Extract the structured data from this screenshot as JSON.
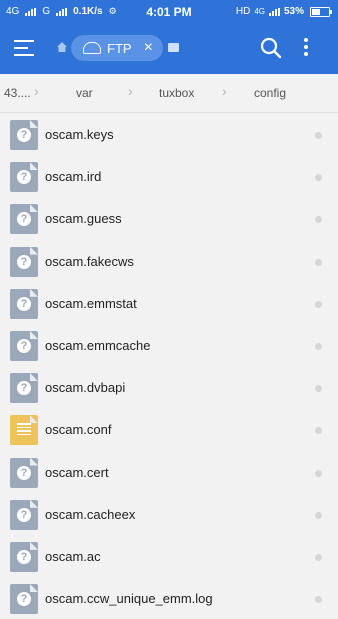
{
  "status_bar": {
    "carrier1": "4G",
    "carrier2": "G",
    "speed": "0.1K/s",
    "time": "4:01 PM",
    "hd": "HD",
    "network": "4G",
    "battery": "53%",
    "battery_level": 0.53
  },
  "app_bar": {
    "tab_label": "FTP",
    "close_glyph": "×",
    "icons": [
      "menu-icon",
      "home-icon",
      "ftp-icon",
      "close-icon",
      "chat-icon",
      "search-icon",
      "more-vert-icon"
    ]
  },
  "breadcrumb": {
    "items": [
      "43....",
      "var",
      "tuxbox",
      "config"
    ]
  },
  "files": [
    {
      "name": "oscam.keys",
      "icon": "unknown-file-icon"
    },
    {
      "name": "oscam.ird",
      "icon": "unknown-file-icon"
    },
    {
      "name": "oscam.guess",
      "icon": "unknown-file-icon"
    },
    {
      "name": "oscam.fakecws",
      "icon": "unknown-file-icon"
    },
    {
      "name": "oscam.emmstat",
      "icon": "unknown-file-icon"
    },
    {
      "name": "oscam.emmcache",
      "icon": "unknown-file-icon"
    },
    {
      "name": "oscam.dvbapi",
      "icon": "unknown-file-icon"
    },
    {
      "name": "oscam.conf",
      "icon": "text-file-icon"
    },
    {
      "name": "oscam.cert",
      "icon": "unknown-file-icon"
    },
    {
      "name": "oscam.cacheex",
      "icon": "unknown-file-icon"
    },
    {
      "name": "oscam.ac",
      "icon": "unknown-file-icon"
    },
    {
      "name": "oscam.ccw_unique_emm.log",
      "icon": "unknown-file-icon"
    }
  ],
  "colors": {
    "primary": "#2f73d9",
    "tab_bg": "#5a93e5",
    "file_icon": "#9ba8ba",
    "conf_icon": "#edc459"
  }
}
